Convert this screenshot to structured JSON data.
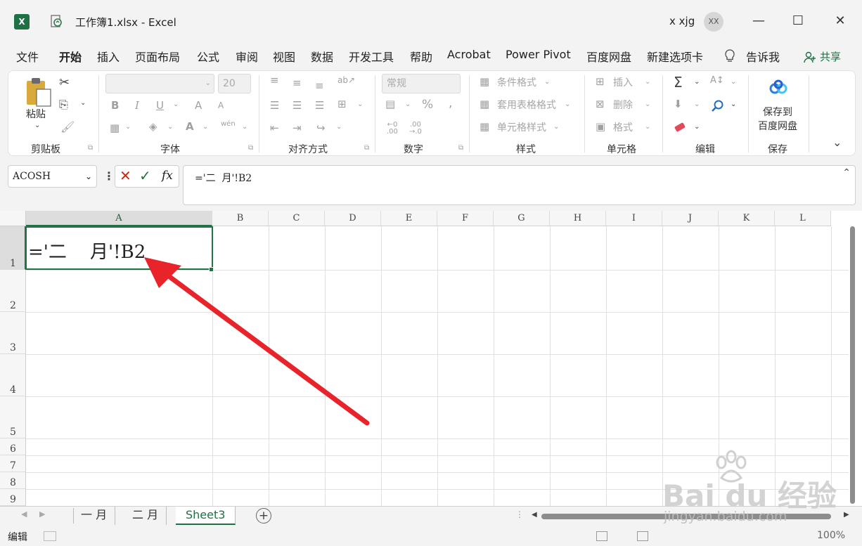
{
  "titlebar": {
    "app_icon": "X",
    "title": "工作簿1.xlsx  -  Excel",
    "user_name": "x xjg",
    "avatar_initials": "XX",
    "minimize": "—",
    "maximize": "☐",
    "close": "✕"
  },
  "menu": {
    "items": [
      "文件",
      "开始",
      "插入",
      "页面布局",
      "公式",
      "审阅",
      "视图",
      "数据",
      "开发工具",
      "帮助",
      "Acrobat",
      "Power Pivot",
      "百度网盘",
      "新建选项卡",
      "告诉我"
    ],
    "share": "共享"
  },
  "ribbon": {
    "clipboard": {
      "paste": "粘贴",
      "label": "剪贴板"
    },
    "font": {
      "size": "20",
      "label": "字体",
      "bold": "B",
      "italic": "I",
      "underline": "U",
      "grow": "A",
      "shrink": "A",
      "font_color": "A",
      "phonetic": "wén"
    },
    "alignment": {
      "label": "对齐方式"
    },
    "number": {
      "format": "常规",
      "percent": "%",
      "comma": ",",
      "label": "数字"
    },
    "styles": {
      "conditional": "条件格式",
      "table": "套用表格格式",
      "cell": "单元格样式",
      "label": "样式"
    },
    "cells": {
      "insert": "插入",
      "delete": "删除",
      "format": "格式",
      "label": "单元格"
    },
    "editing": {
      "label": "编辑",
      "sum": "Σ"
    },
    "save": {
      "button": "保存到\n百度网盘",
      "line1": "保存到",
      "line2": "百度网盘",
      "label": "保存"
    }
  },
  "formula_bar": {
    "name_box": "ACOSH",
    "cancel": "✕",
    "enter": "✓",
    "fx": "fx",
    "content": "='二  月'!B2"
  },
  "grid": {
    "columns": [
      "A",
      "B",
      "C",
      "D",
      "E",
      "F",
      "G",
      "H",
      "I",
      "J",
      "K",
      "L"
    ],
    "rows": [
      "1",
      "2",
      "3",
      "4",
      "5",
      "6",
      "7",
      "8",
      "9"
    ],
    "a1_value": "='二    月'!B2"
  },
  "sheets": {
    "tabs": [
      "一  月",
      "二  月",
      "Sheet3"
    ],
    "active": "Sheet3",
    "add": "+"
  },
  "status": {
    "mode": "编辑",
    "zoom": "100%"
  },
  "watermark": {
    "brand": "Bai du 经验",
    "url": "jingyan.baidu.com"
  },
  "colors": {
    "excel_green": "#217346",
    "arrow_red": "#e8232a"
  }
}
